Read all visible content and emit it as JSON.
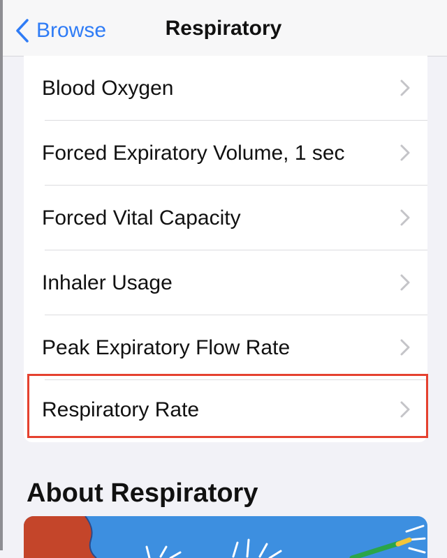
{
  "nav": {
    "back_label": "Browse",
    "title": "Respiratory"
  },
  "list": {
    "items": [
      {
        "label": "Blood Oxygen"
      },
      {
        "label": "Forced Expiratory Volume, 1 sec"
      },
      {
        "label": "Forced Vital Capacity"
      },
      {
        "label": "Inhaler Usage"
      },
      {
        "label": "Peak Expiratory Flow Rate"
      },
      {
        "label": "Respiratory Rate"
      }
    ],
    "highlighted_item": "Respiratory Rate"
  },
  "about": {
    "title": "About Respiratory"
  },
  "colors": {
    "accent": "#2f7cf6",
    "highlight_border": "#e5412f",
    "art_blue": "#3d8fe0",
    "art_red": "#c4452a"
  },
  "icons": {
    "back": "chevron-left-icon",
    "row": "chevron-right-icon"
  }
}
